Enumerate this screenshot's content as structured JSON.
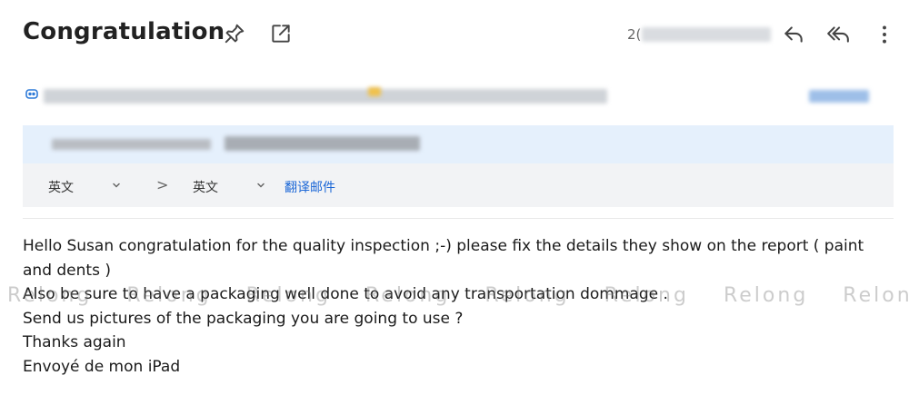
{
  "header": {
    "subject": "Congratulation",
    "date_visible_prefix": "2(",
    "icons": {
      "pin": "pin-icon",
      "open_external": "open-in-new-window-icon",
      "reply": "reply-icon",
      "reply_all": "reply-all-icon",
      "more": "more-vertical-icon"
    }
  },
  "translation_bar": {
    "source_language": "英文",
    "target_language": "英文",
    "arrow": ">",
    "translate_label": "翻译邮件"
  },
  "body": {
    "lines": [
      "Hello Susan congratulation for the quality inspection ;-) please fix the details they show on the report ( paint",
      "and dents )",
      "Also be sure to have a packaging well done to avoid any transportation dommage .",
      "Send us pictures of the packaging you are going to use ?",
      "Thanks again",
      "Envoyé de mon iPad"
    ]
  },
  "watermark": {
    "text": [
      "Relong",
      "Relong",
      "Relong",
      "Relong",
      "Relong",
      "Relong",
      "Relong",
      "Relong",
      "R"
    ]
  },
  "colors": {
    "accent_blue": "#1a66d6",
    "translation_bg": "#e5f0fc",
    "language_bar_bg": "#f2f3f5",
    "icon_gray": "#555555"
  }
}
